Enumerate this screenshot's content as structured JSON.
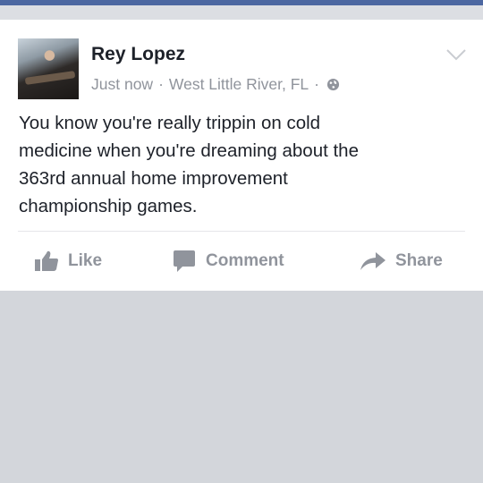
{
  "post": {
    "author": "Rey Lopez",
    "timestamp": "Just now",
    "location": "West Little River, FL",
    "separator": "·",
    "privacy_icon": "globe-icon",
    "menu_icon": "chevron-down-icon",
    "text_lines": [
      "You know you're really trippin on cold",
      "medicine when you're dreaming about the",
      "363rd annual home improvement",
      "championship games."
    ]
  },
  "actions": {
    "like_label": "Like",
    "comment_label": "Comment",
    "share_label": "Share"
  },
  "colors": {
    "top_bar": "#4c67a1",
    "background": "#d3d6db",
    "card": "#ffffff",
    "text_primary": "#1d2129",
    "text_secondary": "#90949c"
  }
}
